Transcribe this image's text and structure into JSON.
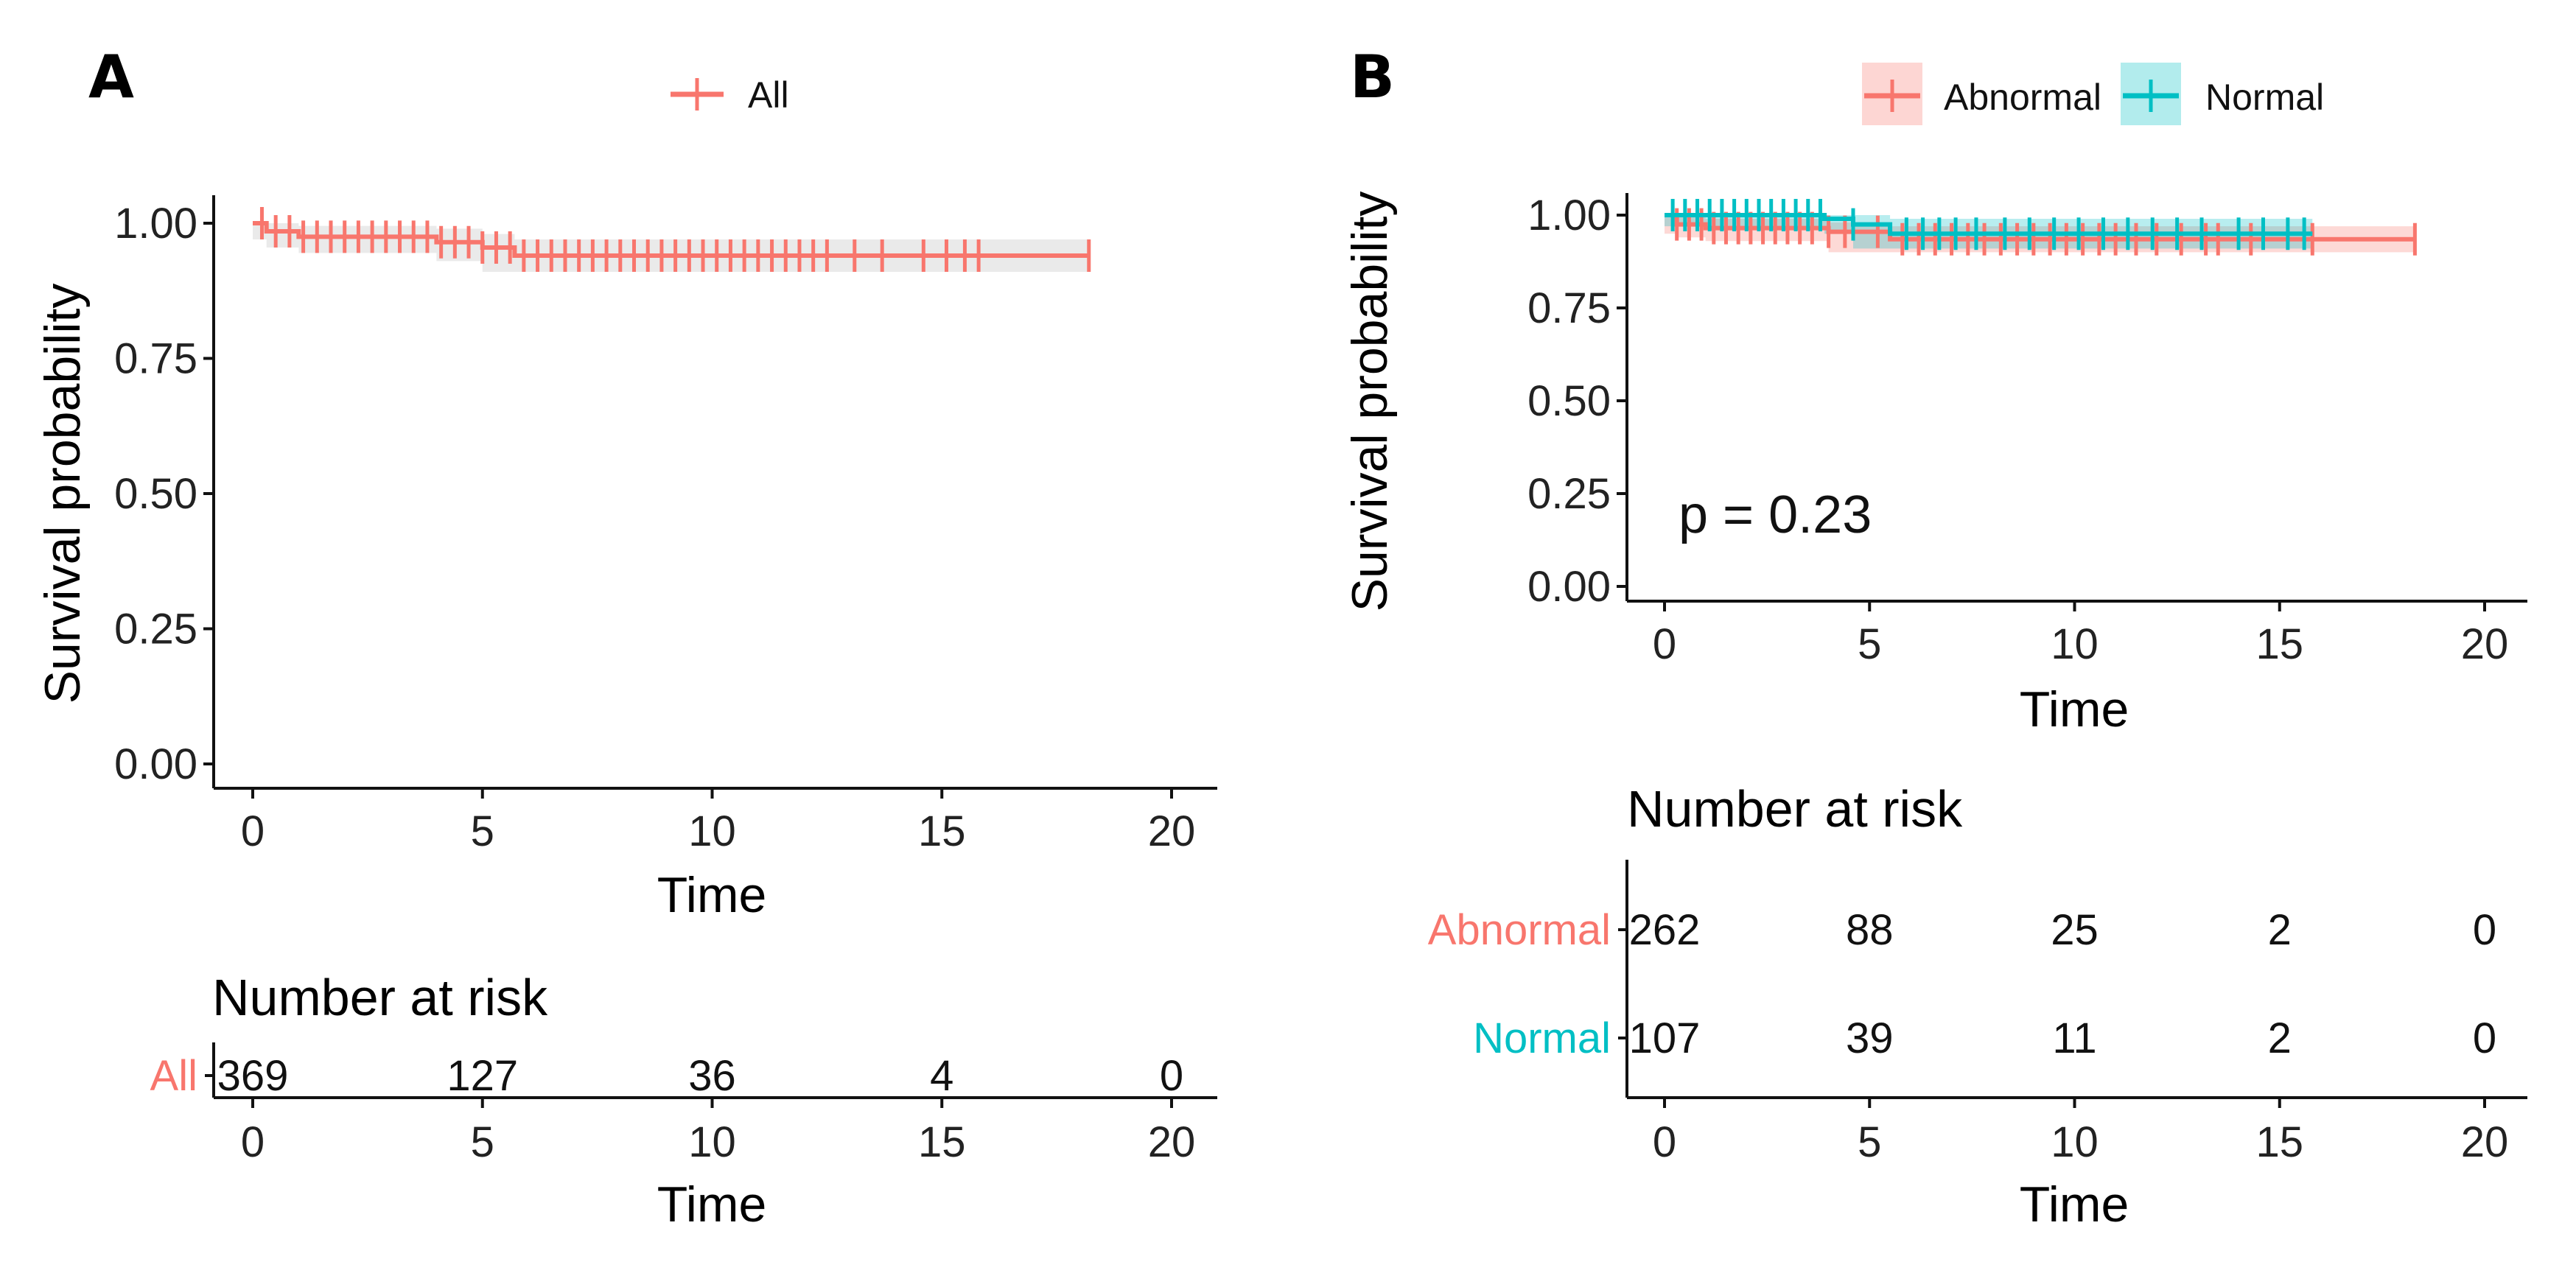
{
  "panels": [
    {
      "letter": "A",
      "legend": [
        {
          "label": "All",
          "color": "#F8766D"
        }
      ],
      "ylabel": "Survival probability",
      "xlabel": "Time",
      "risk_title": "Number at risk",
      "risk_xlabel": "Time",
      "risk_rows": [
        {
          "label": "All",
          "color": "#F8766D",
          "values": [
            "369",
            "127",
            "36",
            "4",
            "0"
          ]
        }
      ]
    },
    {
      "letter": "B",
      "legend": [
        {
          "label": "Abnormal",
          "color": "#F8766D"
        },
        {
          "label": "Normal",
          "color": "#00BFC4"
        }
      ],
      "ylabel": "Survival probability",
      "xlabel": "Time",
      "pvalue": "p = 0.23",
      "risk_title": "Number at risk",
      "risk_xlabel": "Time",
      "risk_rows": [
        {
          "label": "Abnormal",
          "color": "#F8766D",
          "values": [
            "262",
            "88",
            "25",
            "2",
            "0"
          ]
        },
        {
          "label": "Normal",
          "color": "#00BFC4",
          "values": [
            "107",
            "39",
            "11",
            "2",
            "0"
          ]
        }
      ]
    }
  ],
  "chart_data": [
    {
      "type": "line",
      "title": "A",
      "xlabel": "Time",
      "ylabel": "Survival probability",
      "xlim": [
        0,
        20
      ],
      "ylim": [
        0,
        1
      ],
      "xticks": [
        "0",
        "5",
        "10",
        "15",
        "20"
      ],
      "yticks": [
        "0.00",
        "0.25",
        "0.50",
        "0.75",
        "1.00"
      ],
      "legend_position": "top",
      "series": [
        {
          "name": "All",
          "color": "#F8766D",
          "x": [
            0,
            0.3,
            1.0,
            4.0,
            5.0,
            5.7,
            18.2
          ],
          "y": [
            1.0,
            0.985,
            0.975,
            0.965,
            0.955,
            0.94,
            0.94
          ],
          "ci_lower": [
            1.0,
            0.97,
            0.955,
            0.945,
            0.93,
            0.91,
            0.91
          ],
          "ci_upper": [
            1.0,
            1.0,
            0.995,
            0.99,
            0.98,
            0.97,
            0.97
          ],
          "censor_x": [
            0.2,
            0.5,
            0.8,
            1.1,
            1.4,
            1.7,
            2.0,
            2.3,
            2.6,
            2.9,
            3.2,
            3.5,
            3.8,
            4.1,
            4.4,
            4.7,
            5.0,
            5.3,
            5.6,
            5.9,
            6.2,
            6.5,
            6.8,
            7.1,
            7.4,
            7.7,
            8.0,
            8.3,
            8.6,
            8.9,
            9.2,
            9.5,
            9.8,
            10.1,
            10.4,
            10.7,
            11.0,
            11.3,
            11.6,
            11.9,
            12.2,
            12.5,
            13.1,
            13.7,
            14.6,
            15.1,
            15.5,
            15.8,
            18.2
          ]
        }
      ]
    },
    {
      "type": "line",
      "title": "B",
      "xlabel": "Time",
      "ylabel": "Survival probability",
      "xlim": [
        0,
        20
      ],
      "ylim": [
        0,
        1
      ],
      "xticks": [
        "0",
        "5",
        "10",
        "15",
        "20"
      ],
      "yticks": [
        "0.00",
        "0.25",
        "0.50",
        "0.75",
        "1.00"
      ],
      "legend_position": "top",
      "annotation": "p = 0.23",
      "series": [
        {
          "name": "Abnormal",
          "color": "#F8766D",
          "x": [
            0,
            0.3,
            1.0,
            4.0,
            5.5,
            18.3
          ],
          "y": [
            1.0,
            0.975,
            0.965,
            0.955,
            0.935,
            0.935
          ],
          "ci_lower": [
            1.0,
            0.95,
            0.94,
            0.93,
            0.9,
            0.9
          ],
          "ci_upper": [
            1.0,
            1.0,
            0.99,
            0.98,
            0.97,
            0.97
          ],
          "censor_x": [
            0.3,
            0.6,
            0.9,
            1.2,
            1.5,
            1.8,
            2.1,
            2.4,
            2.7,
            3.0,
            3.3,
            3.6,
            4.0,
            4.4,
            5.2,
            5.8,
            6.2,
            6.6,
            7.0,
            7.4,
            7.8,
            8.2,
            8.6,
            9.0,
            9.4,
            9.8,
            10.2,
            10.6,
            11.0,
            11.5,
            12.0,
            12.6,
            13.2,
            13.5,
            14.3,
            15.8,
            18.3
          ]
        },
        {
          "name": "Normal",
          "color": "#00BFC4",
          "x": [
            0,
            3.9,
            4.6,
            5.5,
            15.8
          ],
          "y": [
            1.0,
            0.99,
            0.975,
            0.95,
            0.95
          ],
          "ci_lower": [
            1.0,
            0.97,
            0.95,
            0.91,
            0.91
          ],
          "ci_upper": [
            1.0,
            1.0,
            1.0,
            0.99,
            0.99
          ],
          "censor_x": [
            0.2,
            0.5,
            0.8,
            1.1,
            1.4,
            1.7,
            2.0,
            2.3,
            2.6,
            2.9,
            3.2,
            3.5,
            3.8,
            4.6,
            5.9,
            6.3,
            6.7,
            7.1,
            7.6,
            8.3,
            8.9,
            9.5,
            10.1,
            10.7,
            11.3,
            11.9,
            12.5,
            13.1,
            14.0,
            14.6,
            15.2,
            15.6
          ]
        }
      ]
    }
  ]
}
